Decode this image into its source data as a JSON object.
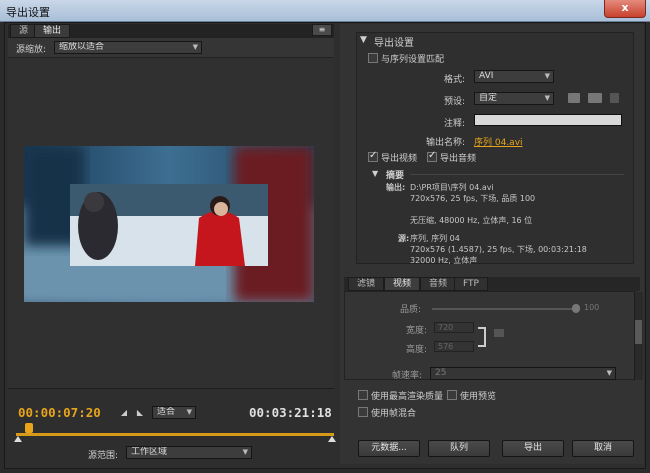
{
  "window": {
    "title": "导出设置",
    "close_label": "x"
  },
  "left_tabs": [
    "源",
    "输出"
  ],
  "panel_menu_icon": "≡",
  "source_scale": {
    "label": "源缩放:",
    "value": "缩放以适合"
  },
  "timeline": {
    "current_time": "00:00:07:20",
    "duration": "00:03:21:18",
    "zoom": "适合",
    "source_range_label": "源范围:",
    "source_range_value": "工作区域"
  },
  "export_settings": {
    "heading": "导出设置",
    "match_sequence": "与序列设置匹配",
    "format_label": "格式:",
    "format_value": "AVI",
    "preset_label": "预设:",
    "preset_value": "自定",
    "comment_label": "注释:",
    "output_name_label": "输出名称:",
    "output_name_value": "序列 04.avi",
    "export_video": "导出视频",
    "export_audio": "导出音频",
    "summary_heading": "摘要",
    "output_label": "输出:",
    "output_lines": [
      "D:\\PR项目\\序列 04.avi",
      "720x576, 25 fps, 下场, 品质 100",
      "",
      "无压缩, 48000 Hz, 立体声, 16 位"
    ],
    "source_label": "源:",
    "source_lines": [
      "序列, 序列 04",
      "720x576 (1.4587), 25 fps, 下场, 00:03:21:18",
      "32000 Hz, 立体声"
    ]
  },
  "right_tabs": [
    "滤镜",
    "视频",
    "音频",
    "FTP"
  ],
  "video_settings": {
    "quality_label": "品质:",
    "quality_value": "100",
    "width_label": "宽度:",
    "width_value": "720",
    "height_label": "高度:",
    "height_value": "576",
    "framerate_label": "帧速率:",
    "framerate_value": "25"
  },
  "options": {
    "max_render_quality": "使用最高渲染质量",
    "use_previews": "使用预览",
    "use_frame_blending": "使用帧混合"
  },
  "buttons": {
    "metadata": "元数据...",
    "queue": "队列",
    "export": "导出",
    "cancel": "取消"
  },
  "colors": {
    "timecode": "#e8a41b",
    "accent": "#e8a41b"
  }
}
